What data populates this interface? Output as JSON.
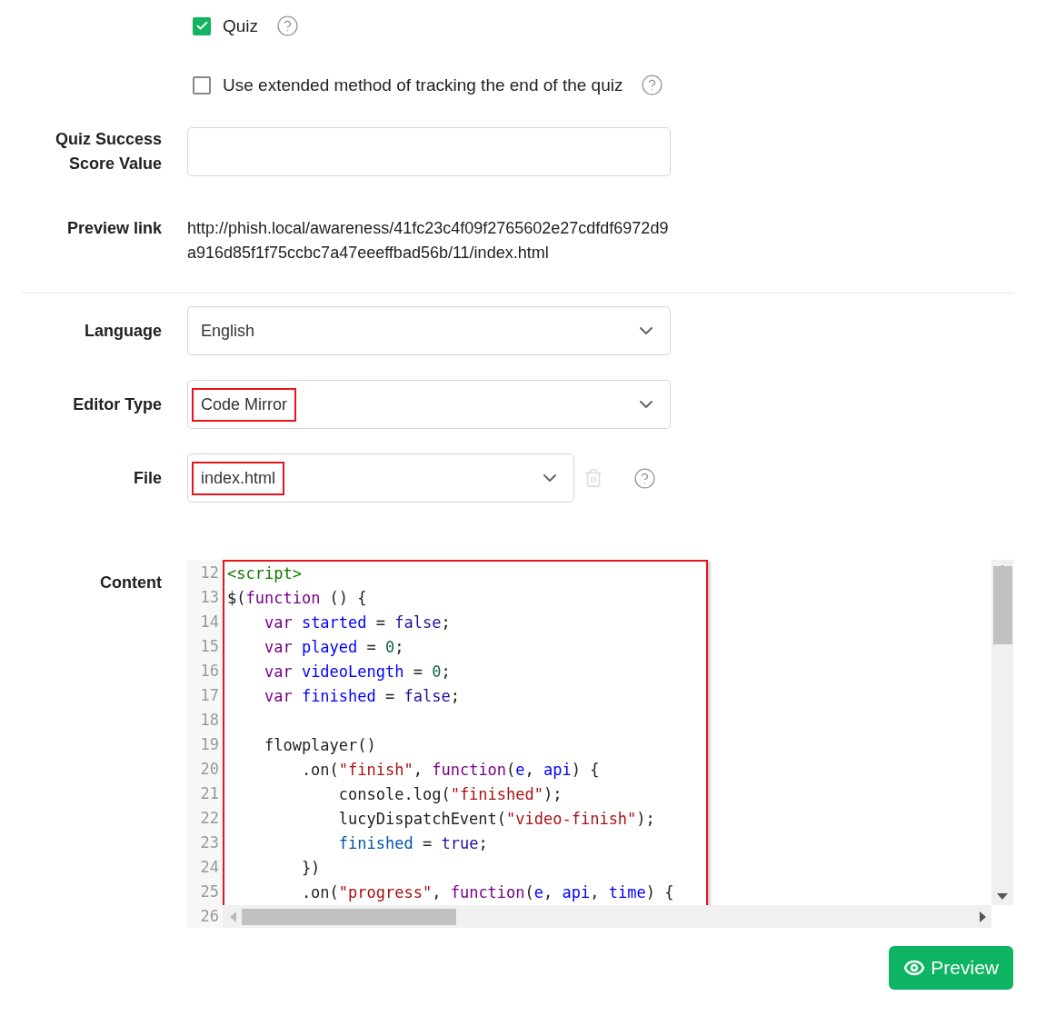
{
  "options": [
    {
      "kind": "checkbox",
      "label": "Quiz",
      "checked": true,
      "help": true
    },
    {
      "kind": "checkbox",
      "label": "Use extended method of tracking the end of the quiz",
      "checked": false,
      "help": true
    }
  ],
  "sections": [
    {
      "fields": [
        {
          "kind": "text_input",
          "label": "Quiz Success Score Value"
        },
        {
          "kind": "text",
          "label": "Preview link",
          "value": "http://phish.local/awareness/41fc23c4f09f2765602e27cdfdf6972d9a916d85f1f75ccbc7a47eeeffbad56b/11/index.html"
        }
      ]
    },
    {
      "fields": [
        {
          "kind": "select",
          "label": "Language",
          "value": "English",
          "highlighted": false
        },
        {
          "kind": "select",
          "label": "Editor Type",
          "value": "Code Mirror",
          "highlighted": true
        },
        {
          "kind": "file_select",
          "label": "File",
          "value": "index.html",
          "highlighted": true,
          "help": true
        },
        {
          "kind": "code",
          "label": "Content",
          "highlighted": true,
          "last_line_number": "26",
          "lines": [
            {
              "number": "12",
              "tokens": [
                {
                  "kind": "tag",
                  "text": "<script>"
                }
              ]
            },
            {
              "number": "13",
              "tokens": [
                {
                  "kind": "plain",
                  "text": "$("
                },
                {
                  "kind": "keyword",
                  "text": "function"
                },
                {
                  "kind": "plain",
                  "text": " () {"
                }
              ]
            },
            {
              "number": "14",
              "tokens": [
                {
                  "kind": "keyword",
                  "text": "    var "
                },
                {
                  "kind": "def",
                  "text": "started"
                },
                {
                  "kind": "plain",
                  "text": " = "
                },
                {
                  "kind": "atom",
                  "text": "false"
                },
                {
                  "kind": "plain",
                  "text": ";"
                }
              ]
            },
            {
              "number": "15",
              "tokens": [
                {
                  "kind": "keyword",
                  "text": "    var "
                },
                {
                  "kind": "def",
                  "text": "played"
                },
                {
                  "kind": "plain",
                  "text": " = "
                },
                {
                  "kind": "number",
                  "text": "0"
                },
                {
                  "kind": "plain",
                  "text": ";"
                }
              ]
            },
            {
              "number": "16",
              "tokens": [
                {
                  "kind": "keyword",
                  "text": "    var "
                },
                {
                  "kind": "def",
                  "text": "videoLength"
                },
                {
                  "kind": "plain",
                  "text": " = "
                },
                {
                  "kind": "number",
                  "text": "0"
                },
                {
                  "kind": "plain",
                  "text": ";"
                }
              ]
            },
            {
              "number": "17",
              "tokens": [
                {
                  "kind": "keyword",
                  "text": "    var "
                },
                {
                  "kind": "def",
                  "text": "finished"
                },
                {
                  "kind": "plain",
                  "text": " = "
                },
                {
                  "kind": "atom",
                  "text": "false"
                },
                {
                  "kind": "plain",
                  "text": ";"
                }
              ]
            },
            {
              "number": "18"
            },
            {
              "number": "19",
              "tokens": [
                {
                  "kind": "plain",
                  "text": "    flowplayer()"
                }
              ]
            },
            {
              "number": "20",
              "tokens": [
                {
                  "kind": "plain",
                  "text": "        .on("
                },
                {
                  "kind": "string",
                  "text": "\"finish\""
                },
                {
                  "kind": "plain",
                  "text": ", "
                },
                {
                  "kind": "keyword",
                  "text": "function"
                },
                {
                  "kind": "plain",
                  "text": "("
                },
                {
                  "kind": "def",
                  "text": "e"
                },
                {
                  "kind": "plain",
                  "text": ", "
                },
                {
                  "kind": "def",
                  "text": "api"
                },
                {
                  "kind": "plain",
                  "text": ") {"
                }
              ]
            },
            {
              "number": "21",
              "tokens": [
                {
                  "kind": "plain",
                  "text": "            console.log("
                },
                {
                  "kind": "string",
                  "text": "\"finished\""
                },
                {
                  "kind": "plain",
                  "text": ");"
                }
              ]
            },
            {
              "number": "22",
              "tokens": [
                {
                  "kind": "plain",
                  "text": "            lucyDispatchEvent("
                },
                {
                  "kind": "string",
                  "text": "\"video-finish\""
                },
                {
                  "kind": "plain",
                  "text": ");"
                }
              ]
            },
            {
              "number": "23",
              "tokens": [
                {
                  "kind": "variable",
                  "text": "            finished"
                },
                {
                  "kind": "plain",
                  "text": " = "
                },
                {
                  "kind": "atom",
                  "text": "true"
                },
                {
                  "kind": "plain",
                  "text": ";"
                }
              ]
            },
            {
              "number": "24",
              "tokens": [
                {
                  "kind": "plain",
                  "text": "        })"
                }
              ]
            },
            {
              "number": "25",
              "tokens": [
                {
                  "kind": "plain",
                  "text": "        .on("
                },
                {
                  "kind": "string",
                  "text": "\"progress\""
                },
                {
                  "kind": "plain",
                  "text": ", "
                },
                {
                  "kind": "keyword",
                  "text": "function"
                },
                {
                  "kind": "plain",
                  "text": "("
                },
                {
                  "kind": "def",
                  "text": "e"
                },
                {
                  "kind": "plain",
                  "text": ", "
                },
                {
                  "kind": "def",
                  "text": "api"
                },
                {
                  "kind": "plain",
                  "text": ", "
                },
                {
                  "kind": "def",
                  "text": "time"
                },
                {
                  "kind": "plain",
                  "text": ") {"
                }
              ]
            }
          ]
        }
      ]
    }
  ],
  "preview_button": {
    "label": "Preview"
  }
}
